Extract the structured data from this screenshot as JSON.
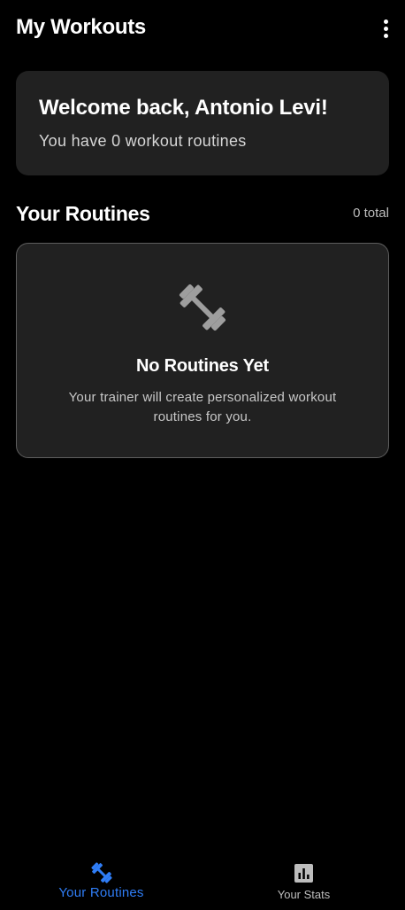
{
  "app_bar": {
    "title": "My Workouts",
    "menu_icon": "more-vert-icon"
  },
  "welcome": {
    "title": "Welcome back, Antonio Levi!",
    "subtitle": "You have 0 workout routines"
  },
  "routines": {
    "heading": "Your Routines",
    "count_label": "0 total",
    "empty_state": {
      "icon": "dumbbell-icon",
      "title": "No Routines Yet",
      "description": "Your trainer will create personalized workout routines for you."
    }
  },
  "bottom_nav": {
    "items": [
      {
        "label": "Your Routines",
        "icon": "dumbbell-icon",
        "active": true
      },
      {
        "label": "Your Stats",
        "icon": "bar-chart-icon",
        "active": false
      }
    ]
  },
  "colors": {
    "background": "#000000",
    "card": "#212121",
    "accent": "#2f7df6",
    "muted_text": "#bdbdbd"
  }
}
